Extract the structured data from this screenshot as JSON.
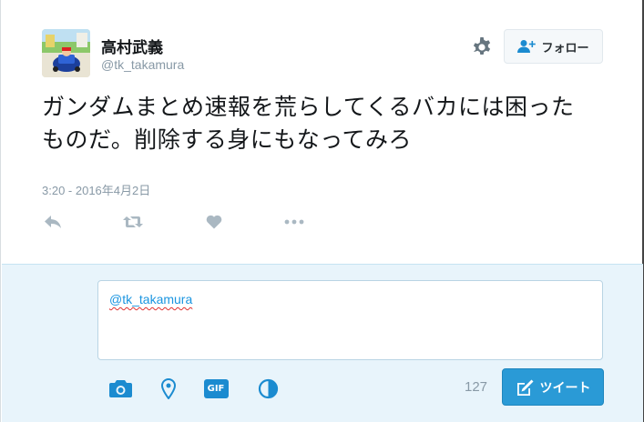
{
  "user": {
    "display_name": "高村武義",
    "screen_name": "@tk_takamura"
  },
  "header": {
    "follow_label": "フォロー"
  },
  "tweet": {
    "line1": "ガンダムまとめ速報を荒らしてくるバカには困った",
    "line2": "ものだ。削除する身にもなってみろ",
    "timestamp": "3:20 - 2016年4月2日"
  },
  "actions": [
    "reply-icon",
    "retweet-icon",
    "like-icon",
    "more-icon"
  ],
  "reply": {
    "value": "@tk_takamura",
    "tools": [
      "camera-icon",
      "location-icon",
      "gif-icon",
      "poll-icon"
    ],
    "gif_label": "GIF",
    "char_count": "127",
    "tweet_label": "ツイート"
  },
  "colors": {
    "accent": "#2a9ad6",
    "icon_gray": "#aab8c2",
    "tool_blue": "#1b8bd0",
    "reply_bg": "#e8f4fb"
  }
}
